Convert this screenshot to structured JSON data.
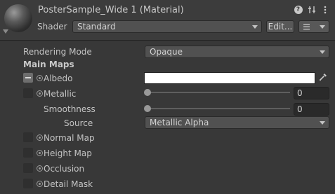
{
  "header": {
    "title": "PosterSample_Wide 1 (Material)",
    "shader_label": "Shader",
    "shader_value": "Standard",
    "edit_button": "Edit...",
    "icons": [
      "help-icon",
      "preset-sliders-icon",
      "kebab-menu-icon"
    ]
  },
  "rendering_mode": {
    "label": "Rendering Mode",
    "value": "Opaque"
  },
  "main_maps": {
    "heading": "Main Maps",
    "albedo": {
      "label": "Albedo",
      "color": "#ffffff"
    },
    "metallic": {
      "label": "Metallic",
      "value": "0",
      "fraction": 0
    },
    "smoothness": {
      "label": "Smoothness",
      "value": "0",
      "fraction": 0
    },
    "source": {
      "label": "Source",
      "value": "Metallic Alpha"
    },
    "normal_map": {
      "label": "Normal Map"
    },
    "height_map": {
      "label": "Height Map"
    },
    "occlusion": {
      "label": "Occlusion"
    },
    "detail_mask": {
      "label": "Detail Mask"
    }
  }
}
